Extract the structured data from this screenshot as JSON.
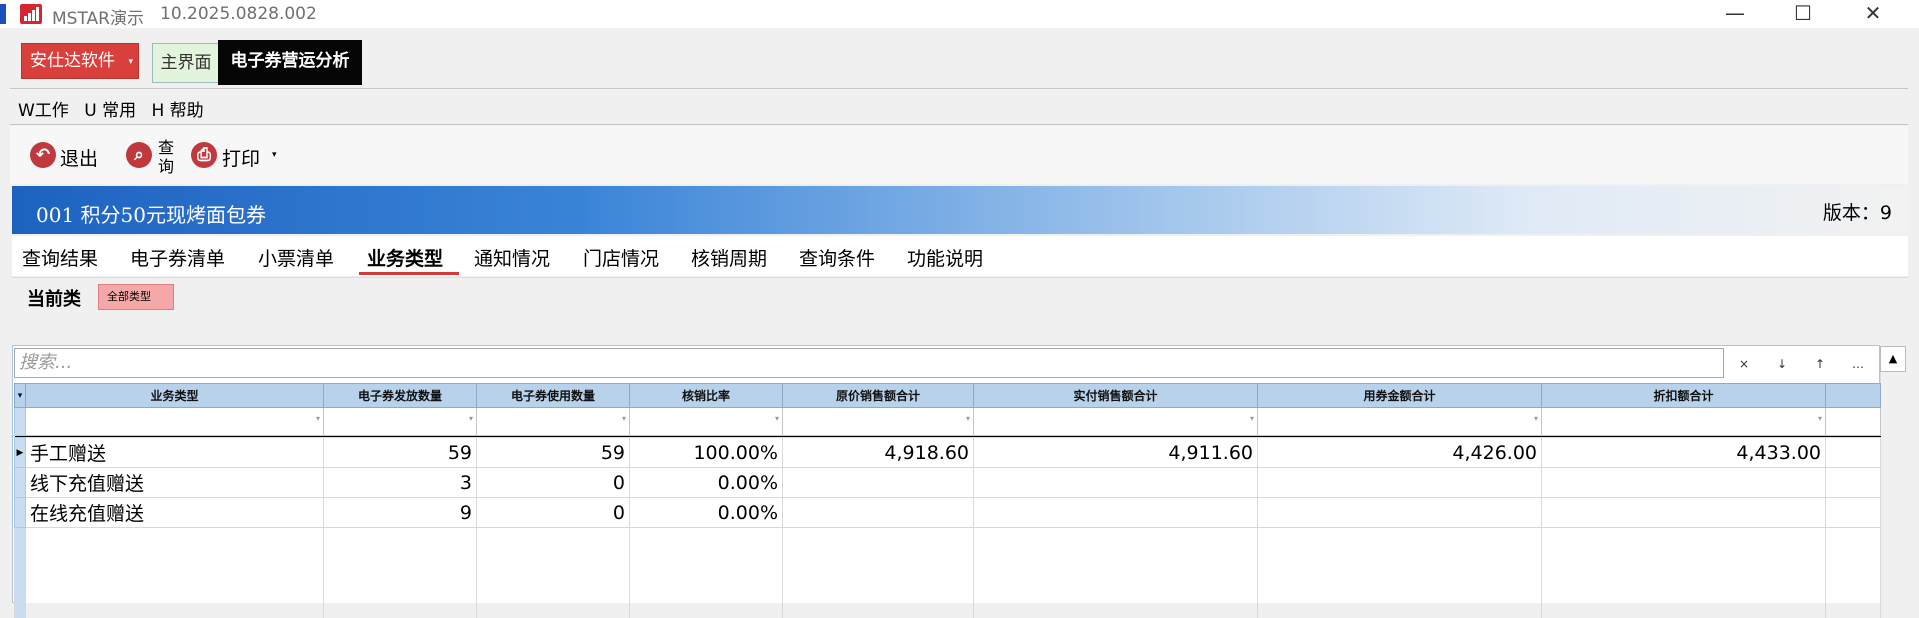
{
  "window": {
    "title": "MSTAR演示",
    "version": "10.2025.0828.002",
    "minimize_glyph": "—",
    "maximize_glyph": "☐",
    "close_glyph": "✕"
  },
  "tabs": {
    "company": "安仕达软件",
    "company_caret": "▾",
    "main": "主界面",
    "active": "电子券营运分析"
  },
  "menu": [
    "W工作",
    "U 常用",
    "H 帮助"
  ],
  "toolbar": {
    "exit": "退出",
    "query_line1": "查",
    "query_line2": "询",
    "print": "打印",
    "print_caret": "▾"
  },
  "header": {
    "title": "001  积分50元现烤面包券",
    "version": "版本：9"
  },
  "subtabs": [
    "查询结果",
    "电子券清单",
    "小票清单",
    "业务类型",
    "通知情况",
    "门店情况",
    "核销周期",
    "查询条件",
    "功能说明"
  ],
  "active_subtab": "业务类型",
  "current": {
    "label": "当前类",
    "badge": "全部类型"
  },
  "search": {
    "placeholder": "搜索...",
    "buttons": [
      "×",
      "↓",
      "↑",
      "…"
    ]
  },
  "scroll": {
    "up_glyph": "▲"
  },
  "table": {
    "columns": [
      "业务类型",
      "电子券发放数量",
      "电子券使用数量",
      "核销比率",
      "原价销售额合计",
      "实付销售额合计",
      "用券金额合计",
      "折扣额合计"
    ],
    "rows": [
      {
        "type": "手工赠送",
        "issued": "59",
        "used": "59",
        "ratio": "100.00%",
        "orig": "4,918.60",
        "paid": "4,911.60",
        "coupon": "4,426.00",
        "discount": "4,433.00",
        "current": true
      },
      {
        "type": "线下充值赠送",
        "issued": "3",
        "used": "0",
        "ratio": "0.00%",
        "orig": "",
        "paid": "",
        "coupon": "",
        "discount": "",
        "current": false
      },
      {
        "type": "在线充值赠送",
        "issued": "9",
        "used": "0",
        "ratio": "0.00%",
        "orig": "",
        "paid": "",
        "coupon": "",
        "discount": "",
        "current": false
      }
    ],
    "corner_glyph": "▾",
    "current_row_glyph": "▶"
  },
  "colors": {
    "brand_red": "#d9403c",
    "active_tab_bg": "#050505",
    "header_blue": "#1e62c0",
    "underline": "#d43a3a"
  }
}
